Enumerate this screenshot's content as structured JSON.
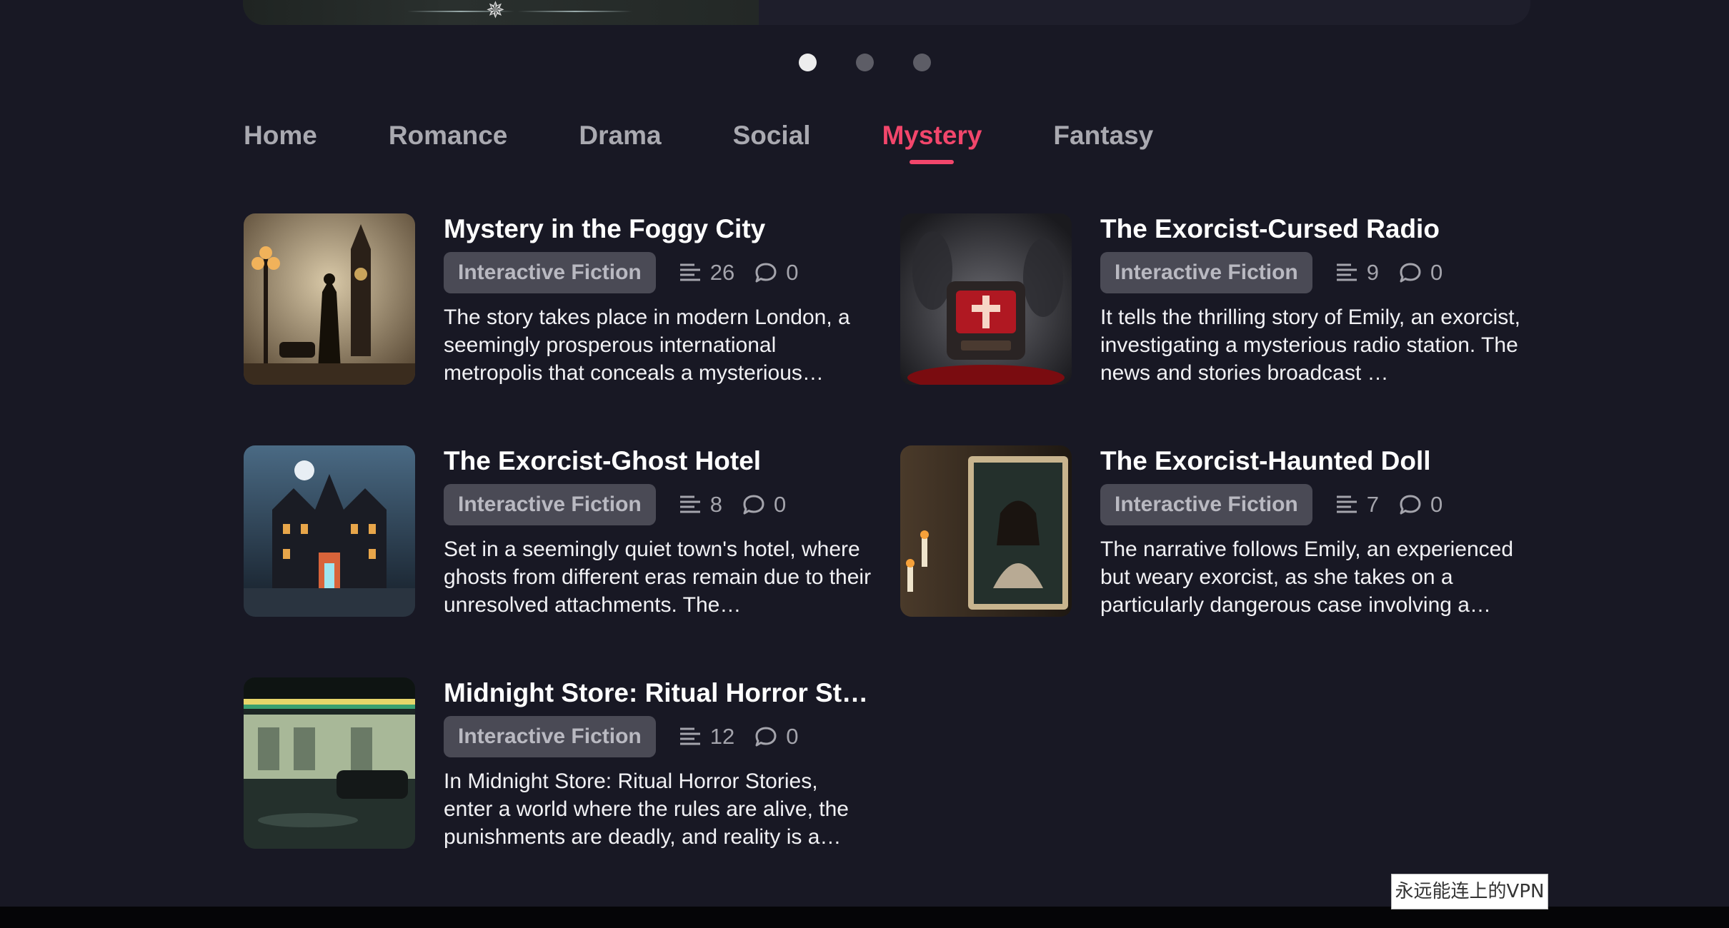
{
  "carousel": {
    "dot_count": 3,
    "active_index": 0
  },
  "tabs": [
    {
      "label": "Home",
      "active": false
    },
    {
      "label": "Romance",
      "active": false
    },
    {
      "label": "Drama",
      "active": false
    },
    {
      "label": "Social",
      "active": false
    },
    {
      "label": "Mystery",
      "active": true
    },
    {
      "label": "Fantasy",
      "active": false
    }
  ],
  "colors": {
    "accent": "#f2466b",
    "background": "#181824",
    "tag_bg": "#4a4a55"
  },
  "cards": [
    {
      "title": "Mystery in the Foggy City",
      "tag": "Interactive Fiction",
      "chapters": "26",
      "comments": "0",
      "description": "The story takes place in modern London, a seemingly prosperous international metropolis that conceals a mysterious…"
    },
    {
      "title": "The Exorcist-Cursed Radio",
      "tag": "Interactive Fiction",
      "chapters": "9",
      "comments": "0",
      "description": "It tells the thrilling story of Emily, an exorcist, investigating a mysterious radio station. The news and stories broadcast …"
    },
    {
      "title": "The Exorcist-Ghost Hotel",
      "tag": "Interactive Fiction",
      "chapters": "8",
      "comments": "0",
      "description": "Set in a seemingly quiet town's hotel, where ghosts from different eras remain due to their unresolved attachments. The…"
    },
    {
      "title": "The Exorcist-Haunted Doll",
      "tag": "Interactive Fiction",
      "chapters": "7",
      "comments": "0",
      "description": "The narrative follows Emily, an experienced but weary exorcist, as she takes on a particularly dangerous case involving a…"
    },
    {
      "title": "Midnight Store: Ritual Horror St…",
      "tag": "Interactive Fiction",
      "chapters": "12",
      "comments": "0",
      "description": "In Midnight Store: Ritual Horror Stories, enter a world where the rules are alive, the punishments are deadly, and reality is a…"
    }
  ],
  "vpn_label": "永远能连上的VPN",
  "icons": {
    "chapters": "list-lines-icon",
    "comments": "speech-bubble-icon",
    "banner": "winged-emblem-icon"
  }
}
